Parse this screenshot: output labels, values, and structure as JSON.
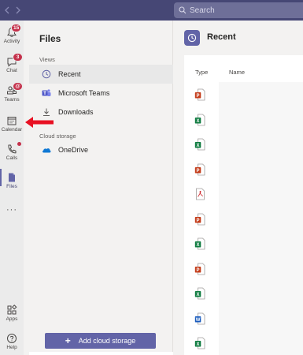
{
  "topbar": {
    "search_placeholder": "Search"
  },
  "rail": {
    "items": [
      {
        "label": "Activity",
        "icon": "bell-icon",
        "badge": "15"
      },
      {
        "label": "Chat",
        "icon": "chat-icon",
        "badge": "3"
      },
      {
        "label": "Teams",
        "icon": "teams-icon",
        "badge": "@"
      },
      {
        "label": "Calendar",
        "icon": "calendar-icon"
      },
      {
        "label": "Calls",
        "icon": "phone-icon"
      },
      {
        "label": "Files",
        "icon": "files-icon"
      },
      {
        "label": "Apps",
        "icon": "apps-icon"
      },
      {
        "label": "Help",
        "icon": "help-icon"
      }
    ],
    "more": "···"
  },
  "files_panel": {
    "title": "Files",
    "views_label": "Views",
    "views": [
      {
        "label": "Recent",
        "icon": "clock-icon"
      },
      {
        "label": "Microsoft Teams",
        "icon": "teams-logo-icon"
      },
      {
        "label": "Downloads",
        "icon": "download-icon"
      }
    ],
    "cloud_label": "Cloud storage",
    "cloud": [
      {
        "label": "OneDrive",
        "icon": "onedrive-icon"
      }
    ],
    "add_button": "Add cloud storage",
    "add_icon": "+"
  },
  "main": {
    "title": "Recent",
    "columns": {
      "type": "Type",
      "name": "Name"
    },
    "file_types": [
      "pptx",
      "xlsx",
      "xlsx",
      "pptx",
      "pdf",
      "pptx",
      "xlsx",
      "pptx",
      "xlsx",
      "docx",
      "xlsx"
    ]
  },
  "colors": {
    "accent": "#6264a7",
    "topbar": "#464775",
    "badge": "#c4314b",
    "powerpoint": "#c43e1c",
    "excel": "#107c41",
    "word": "#185abd"
  }
}
